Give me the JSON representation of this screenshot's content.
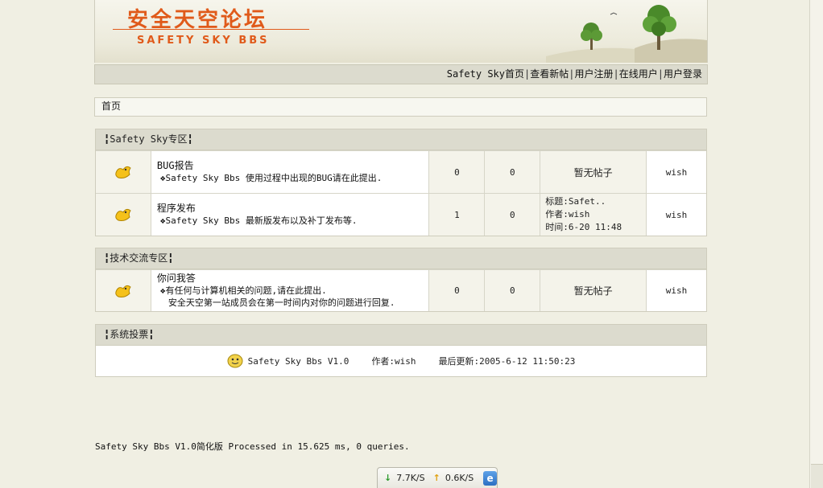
{
  "banner": {
    "title_cn": "安全天空论坛",
    "title_en": "SAFETY SKY BBS"
  },
  "nav": {
    "items": [
      {
        "label": "Safety Sky首页"
      },
      {
        "label": "查看新帖"
      },
      {
        "label": "用户注册"
      },
      {
        "label": "在线用户"
      },
      {
        "label": "用户登录"
      }
    ],
    "separator": "|"
  },
  "breadcrumb": "首页",
  "sections": [
    {
      "title": "╏Safety Sky专区╏",
      "forums": [
        {
          "name": "BUG报告",
          "desc": "❖Safety Sky Bbs 使用过程中出现的BUG请在此提出.",
          "topics": "0",
          "posts": "0",
          "last": "暂无帖子",
          "moderator": "wish"
        },
        {
          "name": "程序发布",
          "desc": "❖Safety Sky Bbs 最新版发布以及补丁发布等.",
          "topics": "1",
          "posts": "0",
          "last_title": "标题:Safet..",
          "last_author": "作者:wish",
          "last_time": "时间:6-20 11:48",
          "moderator": "wish"
        }
      ]
    },
    {
      "title": "╏技术交流专区╏",
      "forums": [
        {
          "name": "你问我答",
          "desc": "❖有任何与计算机相关的问题,请在此提出.",
          "desc2": "安全天空第一站成员会在第一时间内对你的问题进行回复.",
          "topics": "0",
          "posts": "0",
          "last": "暂无帖子",
          "moderator": "wish"
        }
      ]
    }
  ],
  "poll": {
    "title": "╏系统投票╏",
    "name": "Safety Sky Bbs V1.0",
    "author": "作者:wish",
    "updated": "最后更新:2005-6-12 11:50:23"
  },
  "footer": "Safety Sky Bbs V1.0简化版 Processed in 15.625 ms, 0 queries.",
  "speed": {
    "down": "7.7K/S",
    "up": "0.6K/S",
    "ie_glyph": "e"
  },
  "colors": {
    "accent": "#e05a1a",
    "header_bg": "#dcdbce",
    "page_bg": "#f0efe3"
  }
}
